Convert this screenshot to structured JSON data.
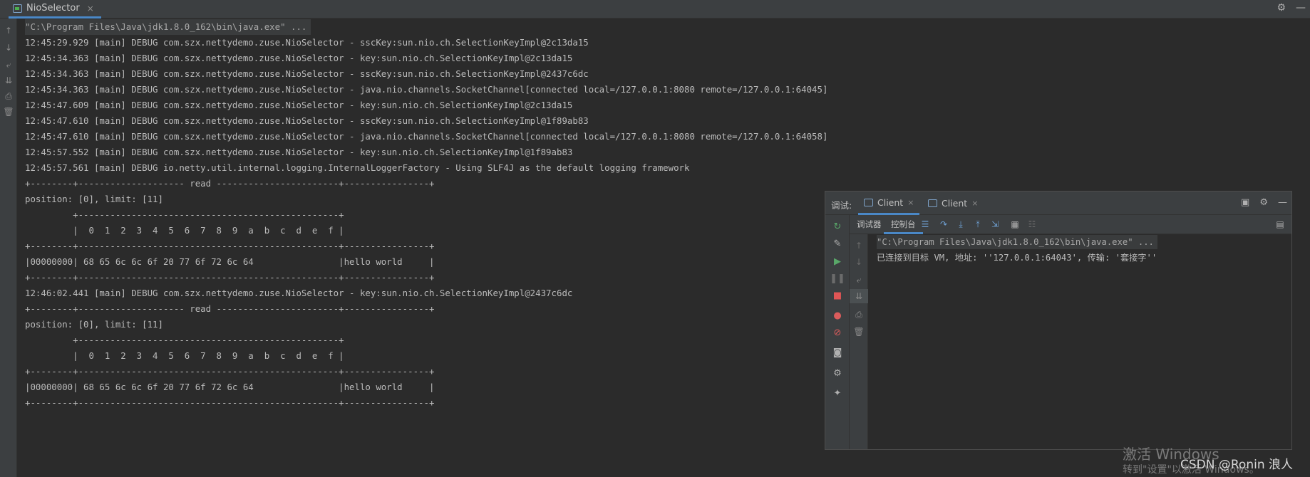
{
  "run_tab": {
    "label": "NioSelector",
    "close": "×",
    "icon": "run-config-icon"
  },
  "top_right_icons": [
    "gear-icon",
    "minimize-icon"
  ],
  "left_strip_icons": [
    "up-arrow-icon",
    "down-arrow-icon",
    "soft-wrap-icon",
    "scroll-to-end-icon",
    "print-icon",
    "trash-icon"
  ],
  "console_lines": [
    "\"C:\\Program Files\\Java\\jdk1.8.0_162\\bin\\java.exe\" ...",
    "12:45:29.929 [main] DEBUG com.szx.nettydemo.zuse.NioSelector - sscKey:sun.nio.ch.SelectionKeyImpl@2c13da15",
    "12:45:34.363 [main] DEBUG com.szx.nettydemo.zuse.NioSelector - key:sun.nio.ch.SelectionKeyImpl@2c13da15",
    "12:45:34.363 [main] DEBUG com.szx.nettydemo.zuse.NioSelector - sscKey:sun.nio.ch.SelectionKeyImpl@2437c6dc",
    "12:45:34.363 [main] DEBUG com.szx.nettydemo.zuse.NioSelector - java.nio.channels.SocketChannel[connected local=/127.0.0.1:8080 remote=/127.0.0.1:64045]",
    "12:45:47.609 [main] DEBUG com.szx.nettydemo.zuse.NioSelector - key:sun.nio.ch.SelectionKeyImpl@2c13da15",
    "12:45:47.610 [main] DEBUG com.szx.nettydemo.zuse.NioSelector - sscKey:sun.nio.ch.SelectionKeyImpl@1f89ab83",
    "12:45:47.610 [main] DEBUG com.szx.nettydemo.zuse.NioSelector - java.nio.channels.SocketChannel[connected local=/127.0.0.1:8080 remote=/127.0.0.1:64058]",
    "12:45:57.552 [main] DEBUG com.szx.nettydemo.zuse.NioSelector - key:sun.nio.ch.SelectionKeyImpl@1f89ab83",
    "12:45:57.561 [main] DEBUG io.netty.util.internal.logging.InternalLoggerFactory - Using SLF4J as the default logging framework",
    "+--------+-------------------- read -----------------------+----------------+",
    "position: [0], limit: [11]",
    "         +-------------------------------------------------+",
    "         |  0  1  2  3  4  5  6  7  8  9  a  b  c  d  e  f |",
    "+--------+-------------------------------------------------+----------------+",
    "|00000000| 68 65 6c 6c 6f 20 77 6f 72 6c 64                |hello world     |",
    "+--------+-------------------------------------------------+----------------+",
    "12:46:02.441 [main] DEBUG com.szx.nettydemo.zuse.NioSelector - key:sun.nio.ch.SelectionKeyImpl@2437c6dc",
    "+--------+-------------------- read -----------------------+----------------+",
    "position: [0], limit: [11]",
    "         +-------------------------------------------------+",
    "         |  0  1  2  3  4  5  6  7  8  9  a  b  c  d  e  f |",
    "+--------+-------------------------------------------------+----------------+",
    "|00000000| 68 65 6c 6c 6f 20 77 6f 72 6c 64                |hello world     |",
    "+--------+-------------------------------------------------+----------------+"
  ],
  "debug_window": {
    "title": "调试:",
    "tabs": [
      {
        "label": "Client",
        "close": "×"
      },
      {
        "label": "Client",
        "close": "×"
      }
    ],
    "sub_tabs": [
      "调试器",
      "控制台"
    ],
    "console_lines": [
      "\"C:\\Program Files\\Java\\jdk1.8.0_162\\bin\\java.exe\" ...",
      "已连接到目标 VM, 地址: ''127.0.0.1:64043', 传输: '套接字''"
    ],
    "colors": {
      "resume": "#59a869",
      "stop": "#e05555",
      "breakpoint": "#db5c5c",
      "accent": "#4a88c7"
    }
  },
  "watermark": {
    "line1": "激活 Windows",
    "line2": "转到\"设置\"以激活 Windows。"
  },
  "credit": "CSDN @Ronin  浪人"
}
